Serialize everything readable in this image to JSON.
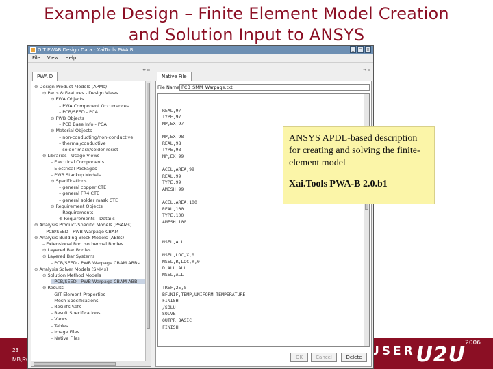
{
  "slide": {
    "title_line1": "Example Design – Finite Element Model Creation",
    "title_line2": "and Solution Input to ANSYS",
    "page_number": "23",
    "footer_text": "MB,RC",
    "logo_text": "U2U",
    "logo_user": "USER",
    "logo_year": "2006"
  },
  "window": {
    "title": "GIT PWAB Design Data : XaiTools PWA B",
    "menu": [
      "File",
      "View",
      "Help"
    ]
  },
  "left_panel": {
    "tab": "PWA D",
    "tree": [
      {
        "indent": 0,
        "glyph": "⊖",
        "label": "Design Product Models (APMs)"
      },
      {
        "indent": 1,
        "glyph": "⊖",
        "label": "Parts & Features - Design Views"
      },
      {
        "indent": 2,
        "glyph": "⊖",
        "label": "PWA Objects"
      },
      {
        "indent": 3,
        "glyph": "",
        "label": "PWA Component Occurrences"
      },
      {
        "indent": 3,
        "glyph": "",
        "label": "PCB/SEED - PCA"
      },
      {
        "indent": 2,
        "glyph": "⊖",
        "label": "PWB Objects"
      },
      {
        "indent": 3,
        "glyph": "",
        "label": "PCB Base Info - PCA"
      },
      {
        "indent": 2,
        "glyph": "⊖",
        "label": "Material Objects"
      },
      {
        "indent": 3,
        "glyph": "",
        "label": "non-conducting/non-conductive"
      },
      {
        "indent": 3,
        "glyph": "",
        "label": "thermal/conductive"
      },
      {
        "indent": 3,
        "glyph": "",
        "label": "solder mask/solder resist"
      },
      {
        "indent": 1,
        "glyph": "⊖",
        "label": "Libraries - Usage Views"
      },
      {
        "indent": 2,
        "glyph": "",
        "label": "Electrical Components"
      },
      {
        "indent": 2,
        "glyph": "",
        "label": "Electrical Packages"
      },
      {
        "indent": 2,
        "glyph": "",
        "label": "PWB Stackup Models"
      },
      {
        "indent": 2,
        "glyph": "⊖",
        "label": "Specifications"
      },
      {
        "indent": 3,
        "glyph": "",
        "label": "general copper CTE"
      },
      {
        "indent": 3,
        "glyph": "",
        "label": "general FR4 CTE"
      },
      {
        "indent": 3,
        "glyph": "",
        "label": "general solder mask CTE"
      },
      {
        "indent": 2,
        "glyph": "⊖",
        "label": "Requirement Objects"
      },
      {
        "indent": 3,
        "glyph": "",
        "label": "Requirements"
      },
      {
        "indent": 3,
        "glyph": "⊕",
        "label": "Requirements - Details"
      },
      {
        "indent": 0,
        "glyph": "⊖",
        "label": "Analysis Product-Specific Models (PSAMs)"
      },
      {
        "indent": 1,
        "glyph": "",
        "label": "PCB/SEED - PWB Warpage CBAM"
      },
      {
        "indent": 0,
        "glyph": "⊖",
        "label": "Analysis Building Block Models (ABBs)"
      },
      {
        "indent": 1,
        "glyph": "",
        "label": "Extensional Rod Isothermal Bodies"
      },
      {
        "indent": 1,
        "glyph": "⊖",
        "label": "Layered Bar Bodies"
      },
      {
        "indent": 1,
        "glyph": "⊖",
        "label": "Layered Bar Systems"
      },
      {
        "indent": 2,
        "glyph": "",
        "label": "PCB/SEED - PWB Warpage CBAM ABBs"
      },
      {
        "indent": 0,
        "glyph": "⊖",
        "label": "Analysis Solver Models (SMMs)"
      },
      {
        "indent": 1,
        "glyph": "⊖",
        "label": "Solution Method Models"
      },
      {
        "indent": 2,
        "glyph": "",
        "label": "PCB/SEED - PWB Warpage CBAM ABB",
        "selected": true
      },
      {
        "indent": 1,
        "glyph": "⊖",
        "label": "Results"
      },
      {
        "indent": 2,
        "glyph": "",
        "label": "GIT Element Properties"
      },
      {
        "indent": 2,
        "glyph": "",
        "label": "Mesh Specifications"
      },
      {
        "indent": 2,
        "glyph": "",
        "label": "Results Sets"
      },
      {
        "indent": 2,
        "glyph": "",
        "label": "Result Specifications"
      },
      {
        "indent": 2,
        "glyph": "",
        "label": "Views"
      },
      {
        "indent": 2,
        "glyph": "",
        "label": "Tables"
      },
      {
        "indent": 2,
        "glyph": "",
        "label": "Image Files"
      },
      {
        "indent": 2,
        "glyph": "",
        "label": "Native Files"
      }
    ]
  },
  "right_panel": {
    "tab": "Native File",
    "file_label": "File Name",
    "file_value": "PCB_SMM_Warpage.txt",
    "code": [
      {
        "line": 8,
        "text": "REAL,97"
      },
      {
        "line": 9,
        "text": "TYPE,97"
      },
      {
        "line": 10,
        "text": "MP,EX,97"
      },
      {
        "line": 12,
        "text": "MP,EX,98"
      },
      {
        "line": 13,
        "text": "REAL,98"
      },
      {
        "line": 14,
        "text": "TYPE,98"
      },
      {
        "line": 15,
        "text": "MP,EX,99"
      },
      {
        "line": 17,
        "text": "ACEL,AREA,99"
      },
      {
        "line": 18,
        "text": "REAL,99"
      },
      {
        "line": 19,
        "text": "TYPE,99"
      },
      {
        "line": 20,
        "text": "AMESH,99"
      },
      {
        "line": 22,
        "text": "ACEL,AREA,100"
      },
      {
        "line": 23,
        "text": "REAL,100"
      },
      {
        "line": 24,
        "text": "TYPE,100"
      },
      {
        "line": 25,
        "text": "AMESH,100"
      },
      {
        "line": 28,
        "text": "NSEL,ALL"
      },
      {
        "line": 30,
        "text": "NSEL,LOC,X,0"
      },
      {
        "line": 31,
        "text": "NSEL,R,LOC,Y,0"
      },
      {
        "line": 32,
        "text": "D,ALL,ALL"
      },
      {
        "line": 33,
        "text": "NSEL,ALL"
      },
      {
        "line": 35,
        "text": "TREF,25,0"
      },
      {
        "line": 36,
        "text": "BFUNIF,TEMP,UNIFORM TEMPERATURE"
      },
      {
        "line": 37,
        "text": "FINISH"
      },
      {
        "line": 38,
        "text": "/SOLU"
      },
      {
        "line": 39,
        "text": "SOLVE"
      },
      {
        "line": 40,
        "text": "OUTPR,BASIC"
      },
      {
        "line": 41,
        "text": "FINISH"
      }
    ],
    "buttons": {
      "ok": "OK",
      "cancel": "Cancel",
      "delete": "Delete"
    }
  },
  "note": {
    "description": "ANSYS APDL-based description for creating and solving the finite-element model",
    "version": "Xai.Tools PWA-B 2.0.b1"
  },
  "colors": {
    "title": "#8b0f24",
    "note_bg": "#fbf5a8",
    "titlebar": "#6d8fb3",
    "footer": "#8b0f24"
  }
}
